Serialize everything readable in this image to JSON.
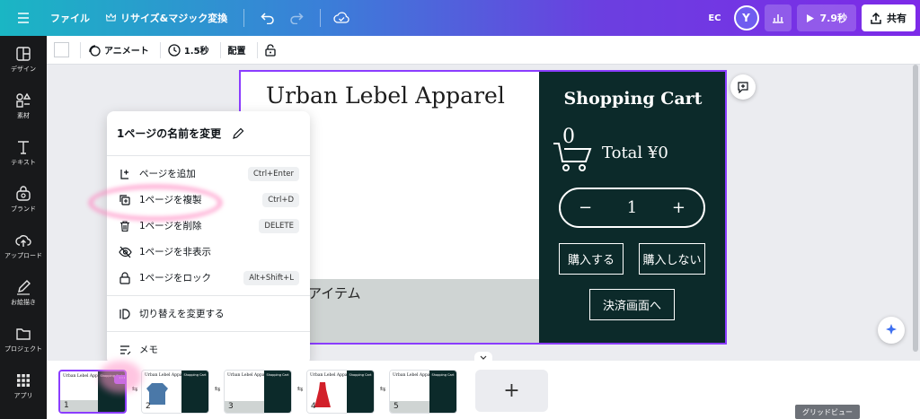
{
  "topbar": {
    "file_label": "ファイル",
    "resize_label": "リサイズ&マジック変換",
    "account_initials": "EC",
    "avatar_letter": "Y",
    "play_duration": "7.9秒",
    "share_label": "共有"
  },
  "sidebar": {
    "items": [
      {
        "label": "デザイン",
        "icon": "design-icon"
      },
      {
        "label": "素材",
        "icon": "elements-icon"
      },
      {
        "label": "テキスト",
        "icon": "text-icon"
      },
      {
        "label": "ブランド",
        "icon": "brand-icon"
      },
      {
        "label": "アップロード",
        "icon": "upload-icon"
      },
      {
        "label": "お絵描き",
        "icon": "draw-icon"
      },
      {
        "label": "プロジェクト",
        "icon": "folder-icon"
      },
      {
        "label": "アプリ",
        "icon": "apps-icon"
      }
    ]
  },
  "toolbar": {
    "animate_label": "アニメート",
    "duration_label": "1.5秒",
    "position_label": "配置"
  },
  "page": {
    "title": "Urban Lebel Apparel",
    "items_label": "アイテム",
    "cart_title": "Shopping Cart",
    "cart_count": "0",
    "total_label": "Total ¥0",
    "quantity_minus": "−",
    "quantity": "1",
    "quantity_plus": "+",
    "buy_label": "購入する",
    "no_buy_label": "購入しない",
    "checkout_label": "決済画面へ"
  },
  "context_menu": {
    "title": "1ページの名前を変更",
    "items": [
      {
        "label": "ページを追加",
        "shortcut": "Ctrl+Enter",
        "icon": "add-page-icon"
      },
      {
        "label": "1ページを複製",
        "shortcut": "Ctrl+D",
        "icon": "duplicate-icon"
      },
      {
        "label": "1ページを削除",
        "shortcut": "DELETE",
        "icon": "trash-icon"
      },
      {
        "label": "1ページを非表示",
        "shortcut": "",
        "icon": "eye-off-icon"
      },
      {
        "label": "1ページをロック",
        "shortcut": "Alt+Shift+L",
        "icon": "lock-icon"
      },
      {
        "label": "切り替えを変更する",
        "shortcut": "",
        "icon": "transition-icon"
      },
      {
        "label": "メモ",
        "shortcut": "",
        "icon": "notes-icon"
      }
    ]
  },
  "thumbnails": [
    {
      "number": "1",
      "title": "Urban Lebel Apparel",
      "cart": "Shopping Cart"
    },
    {
      "number": "2",
      "title": "Urban Lebel Apparel",
      "cart": "Shopping Cart"
    },
    {
      "number": "3",
      "title": "Urban Lebel Apparel",
      "cart": "Shopping Cart"
    },
    {
      "number": "4",
      "title": "Urban Lebel Apparel",
      "cart": "Shopping Cart"
    },
    {
      "number": "5",
      "title": "Urban Lebel Apparel",
      "cart": "Shopping Cart"
    }
  ],
  "add_page_symbol": "+",
  "grid_view_label": "グリッドビュー",
  "colors": {
    "accent": "#8b3dff",
    "cart_bg": "#0c2a2a",
    "sidebar_bg": "#18191b"
  }
}
